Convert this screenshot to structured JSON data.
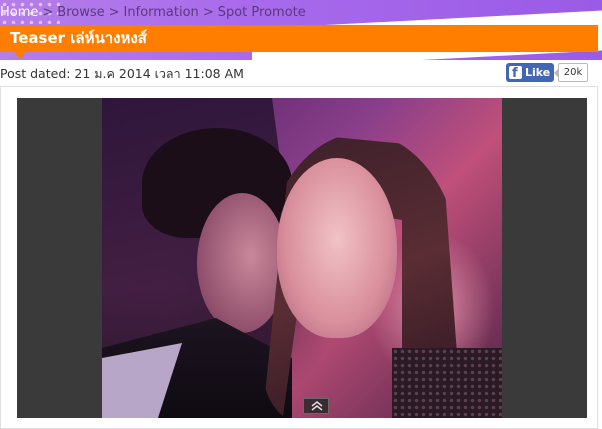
{
  "breadcrumb": {
    "items": [
      "Home",
      "Browse",
      "Information",
      "Spot Promote"
    ],
    "separator": ">"
  },
  "page": {
    "title": "Teaser เล่ห์นางหงส์",
    "post_date": "Post dated: 21 ม.ค 2014 เวลา 11:08 AM"
  },
  "facebook": {
    "like_label": "Like",
    "like_count": "20k",
    "icon": "facebook-icon"
  },
  "video": {
    "controls_icon": "chevron-up-icon"
  },
  "colors": {
    "header_purple": "#a96bec",
    "title_orange": "#ff7e00",
    "facebook_blue": "#4267b2",
    "video_bg": "#3a3a3a"
  }
}
